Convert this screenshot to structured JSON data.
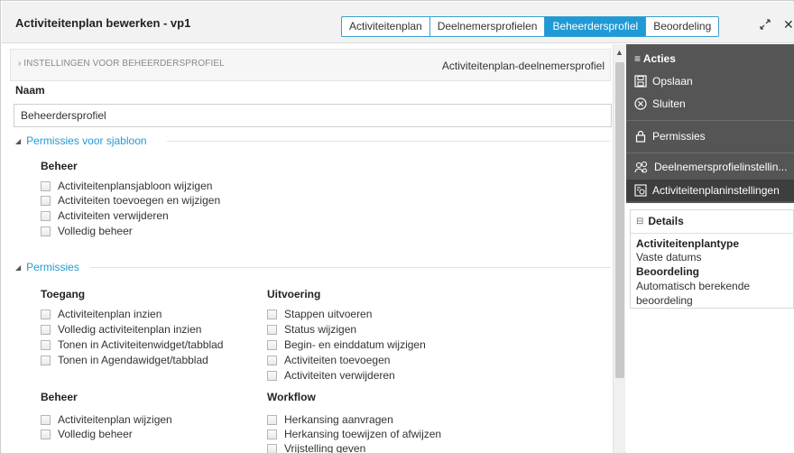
{
  "window": {
    "title": "Activiteitenplan bewerken - vp1",
    "tabs": [
      "Activiteitenplan",
      "Deelnemersprofielen",
      "Beheerdersprofiel",
      "Beoordeling"
    ],
    "active_tab": "Beheerdersprofiel"
  },
  "settings_bar": {
    "label": "› INSTELLINGEN VOOR BEHEERDERSPROFIEL",
    "right_text": "Activiteitenplan-deelnemersprofiel"
  },
  "naam": {
    "label": "Naam",
    "value": "Beheerdersprofiel"
  },
  "sections": {
    "sjabloon": {
      "title": "Permissies voor sjabloon",
      "group_title": "Beheer",
      "items": [
        "Activiteitenplansjabloon wijzigen",
        "Activiteiten toevoegen en wijzigen",
        "Activiteiten verwijderen",
        "Volledig beheer"
      ]
    },
    "permissies": {
      "title": "Permissies",
      "toegang": {
        "title": "Toegang",
        "items": [
          "Activiteitenplan inzien",
          "Volledig activiteitenplan inzien",
          "Tonen in Activiteitenwidget/tabblad",
          "Tonen in Agendawidget/tabblad"
        ]
      },
      "uitvoering": {
        "title": "Uitvoering",
        "items": [
          "Stappen uitvoeren",
          "Status wijzigen",
          "Begin- en einddatum wijzigen",
          "Activiteiten toevoegen",
          "Activiteiten verwijderen"
        ]
      },
      "beheer": {
        "title": "Beheer",
        "items": [
          "Activiteitenplan wijzigen",
          "Volledig beheer"
        ]
      },
      "workflow": {
        "title": "Workflow",
        "items": [
          "Herkansing aanvragen",
          "Herkansing toewijzen of afwijzen",
          "Vrijstelling geven"
        ]
      }
    }
  },
  "sidebar": {
    "acties_title": "Acties",
    "actions": [
      "Opslaan",
      "Sluiten",
      "Permissies",
      "Deelnemersprofielinstellin...",
      "Activiteitenplaninstellingen"
    ],
    "details_title": "Details",
    "details": {
      "type_label": "Activiteitenplantype",
      "type_value": "Vaste datums",
      "beoordeling_label": "Beoordeling",
      "beoordeling_value_1": "Automatisch berekende",
      "beoordeling_value_2": "beoordeling"
    }
  },
  "colors": {
    "accent": "#1f9ad6",
    "sidebar_bg": "#555555",
    "title_bar_bg": "#f2f2f2"
  }
}
